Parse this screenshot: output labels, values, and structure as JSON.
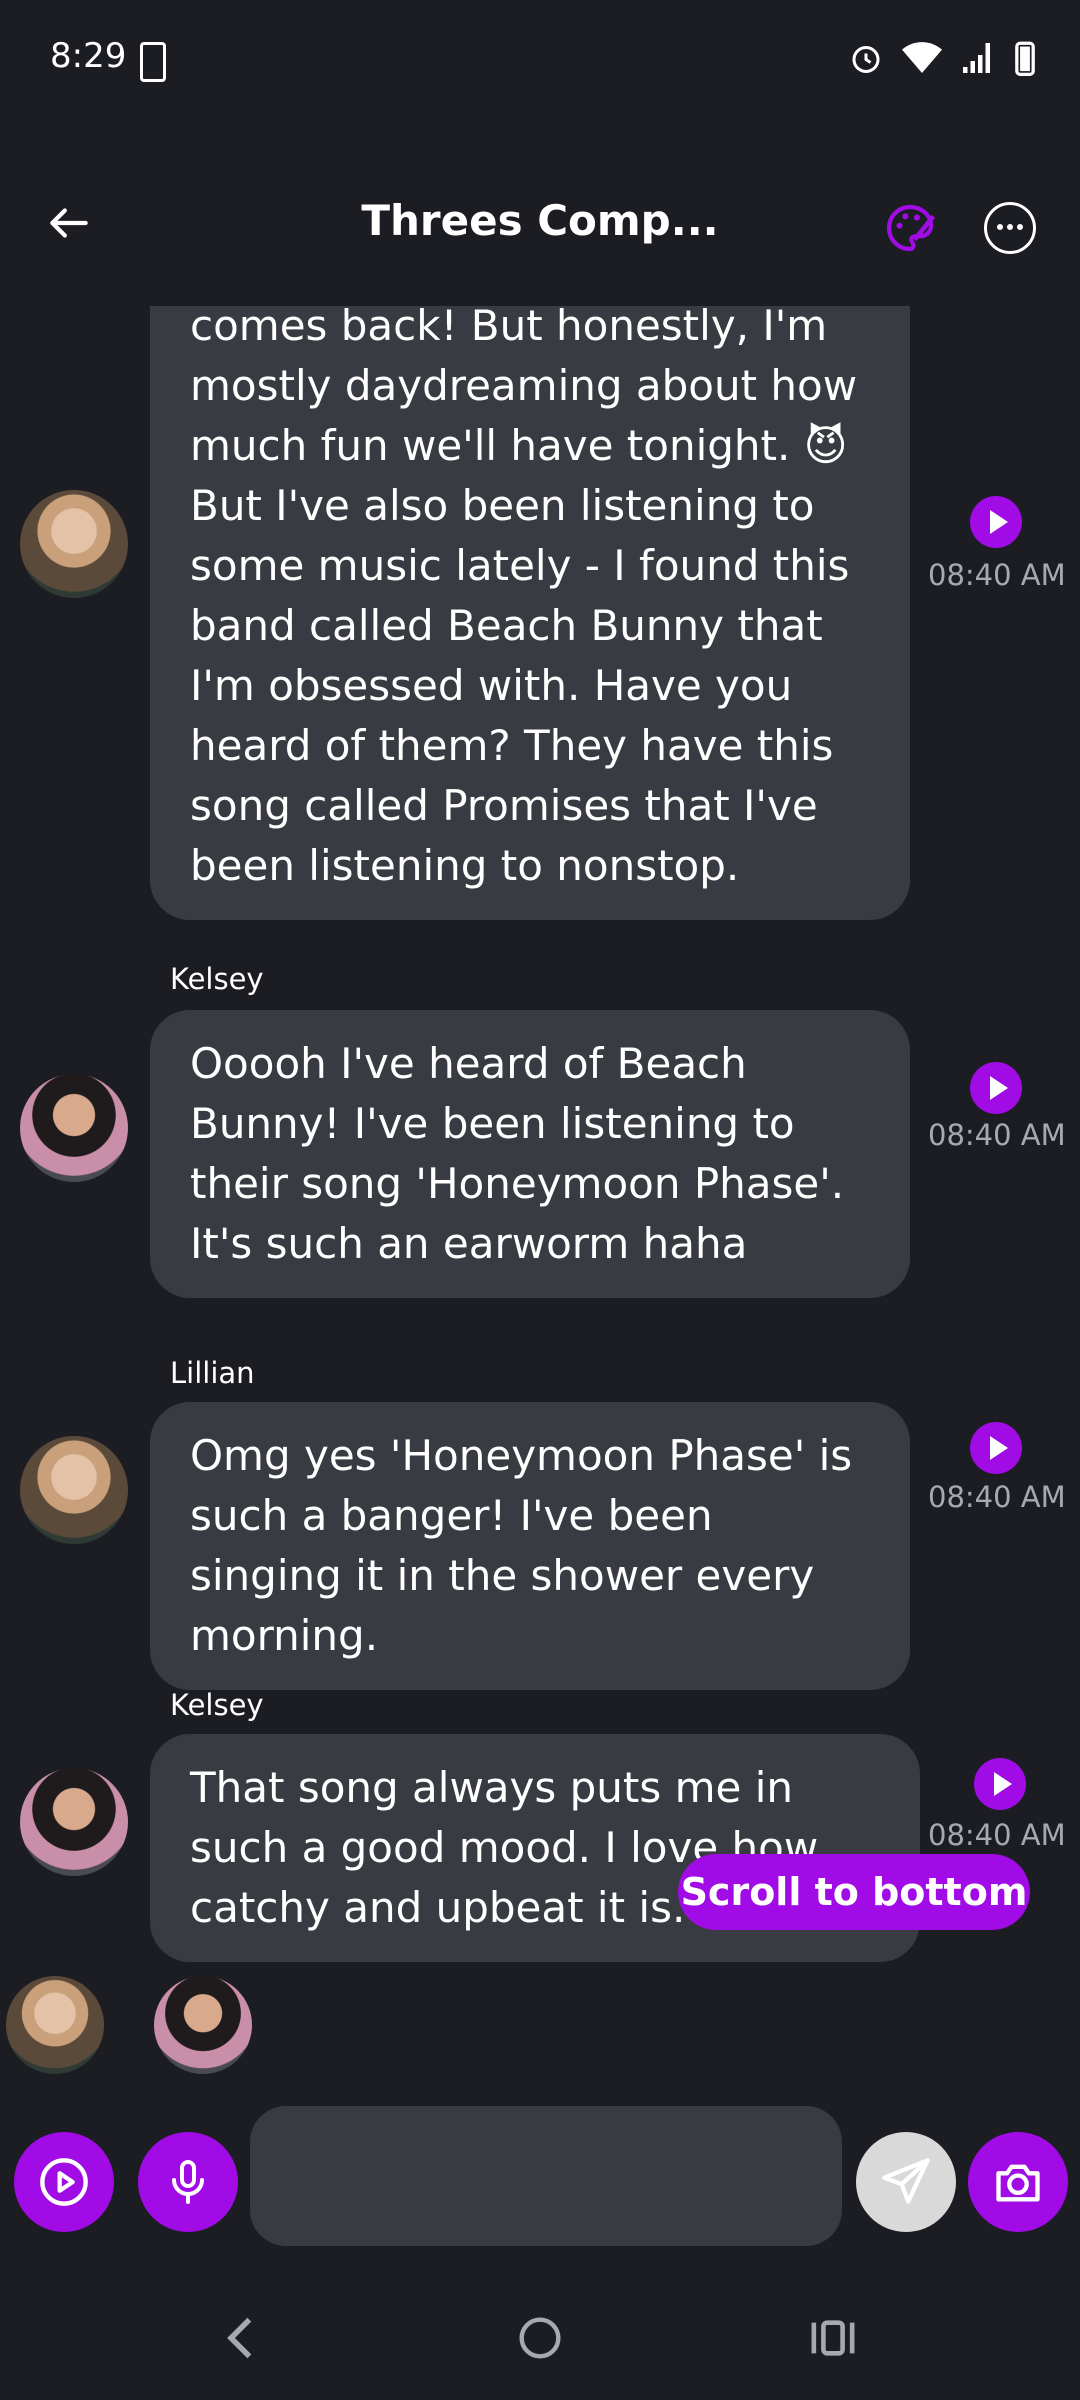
{
  "status_bar": {
    "time": "8:29"
  },
  "header": {
    "title": "Threes Comp..."
  },
  "messages": [
    {
      "sender": "",
      "text": "comes back! But honestly, I'm mostly daydreaming about how much fun we'll have tonight. 😈 But I've also been listening to some music lately - I found this band called Beach Bunny that I'm obsessed with. Have you heard of them? They have this song called Promises that I've been listening to nonstop.",
      "time": "08:40 AM"
    },
    {
      "sender": "Kelsey",
      "text": "Ooooh I've heard of Beach Bunny! I've been listening to their song 'Honeymoon Phase'. It's such an earworm haha",
      "time": "08:40 AM"
    },
    {
      "sender": "Lillian",
      "text": "Omg yes 'Honeymoon Phase' is such a banger! I've been singing it in the shower every morning.",
      "time": "08:40 AM"
    },
    {
      "sender": "Kelsey",
      "text": "That song always puts me in such a good mood. I love how catchy and upbeat it is.",
      "time": "08:40 AM"
    }
  ],
  "scroll_button": {
    "label": "Scroll to bottom"
  },
  "input": {
    "placeholder": ""
  },
  "colors": {
    "accent": "#a00be6",
    "bubble": "#393b43",
    "background": "#1c1d23"
  }
}
